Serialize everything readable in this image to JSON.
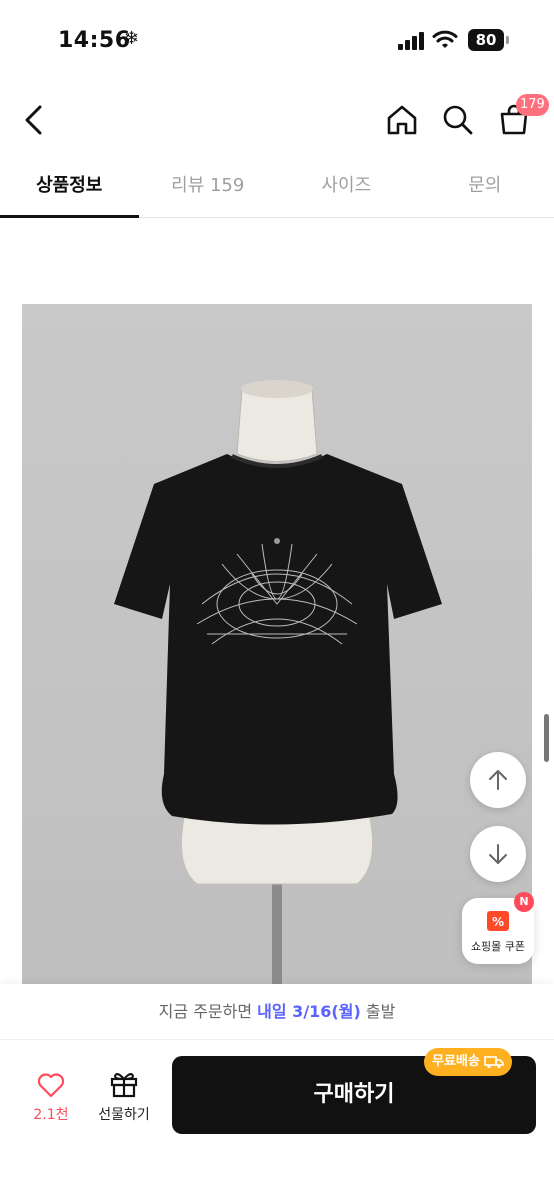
{
  "status_bar": {
    "time": "14:56",
    "battery": "80"
  },
  "nav": {
    "cart_badge": "179"
  },
  "tabs": [
    {
      "label": "상품정보",
      "active": true
    },
    {
      "label": "리뷰 159",
      "active": false
    },
    {
      "label": "사이즈",
      "active": false
    },
    {
      "label": "문의",
      "active": false
    }
  ],
  "coupon": {
    "label": "쇼핑몰 쿠폰",
    "badge": "N"
  },
  "delivery": {
    "prefix": "지금 주문하면 ",
    "date": "내일 3/16(월)",
    "suffix": " 출발"
  },
  "actions": {
    "like_count": "2.1천",
    "gift_label": "선물하기",
    "buy_label": "구매하기",
    "free_shipping": "무료배송"
  },
  "colors": {
    "accent": "#5a63ff",
    "like": "#ff4a5a",
    "badge": "#ff6f7d",
    "free_shipping": "#ffb020"
  }
}
